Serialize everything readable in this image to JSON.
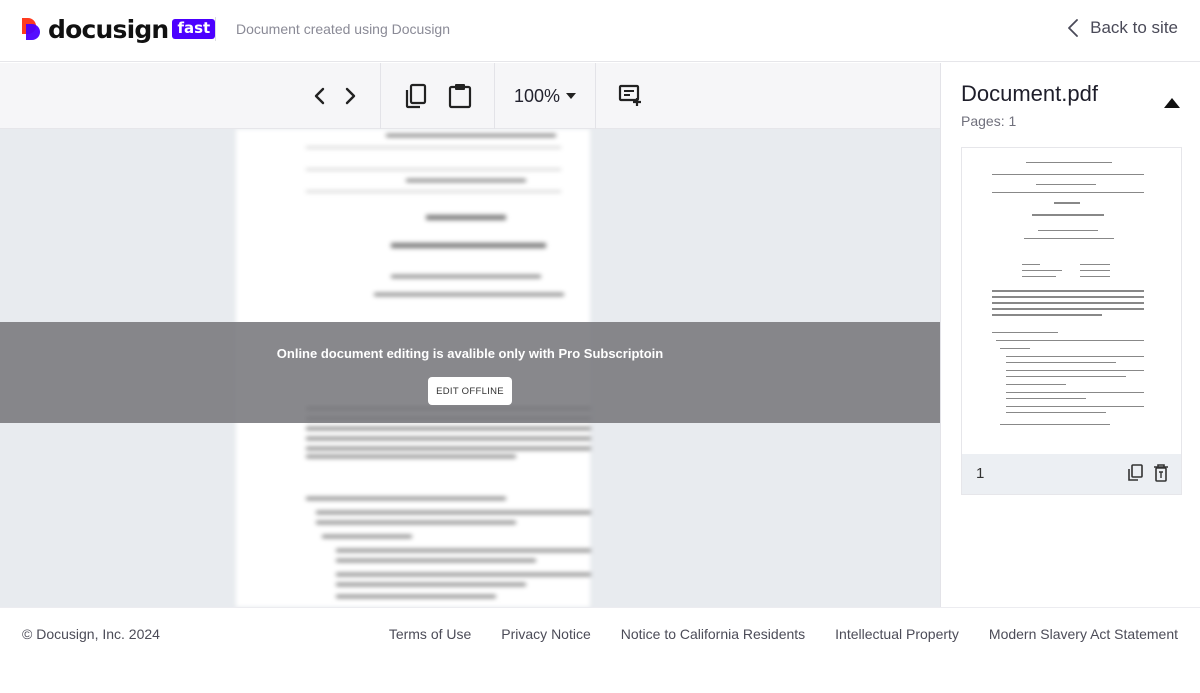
{
  "header": {
    "brand_name": "docusign",
    "brand_badge": "fast",
    "subtitle": "Document created using Docusign",
    "back_label": "Back to site"
  },
  "toolbar": {
    "prev_icon": "chevron-left-icon",
    "next_icon": "chevron-right-icon",
    "copy_icon": "copy-icon",
    "paste_icon": "clipboard-icon",
    "zoom_value": "100%",
    "add_text_icon": "add-text-icon"
  },
  "overlay": {
    "message": "Online document editing is avalible only with Pro Subscriptoin",
    "button_label": "EDIT OFFLINE"
  },
  "sidebar": {
    "file_name": "Document.pdf",
    "pages_label": "Pages: 1",
    "thumbnails": [
      {
        "page_number": "1"
      }
    ]
  },
  "footer": {
    "copyright": "© Docusign, Inc. 2024",
    "links": [
      "Terms of Use",
      "Privacy Notice",
      "Notice to California Residents",
      "Intellectual Property",
      "Modern Slavery Act Statement"
    ]
  },
  "colors": {
    "brand_purple": "#4c00ff",
    "brand_red": "#ff3b1f",
    "overlay_gray": "#78787c"
  }
}
